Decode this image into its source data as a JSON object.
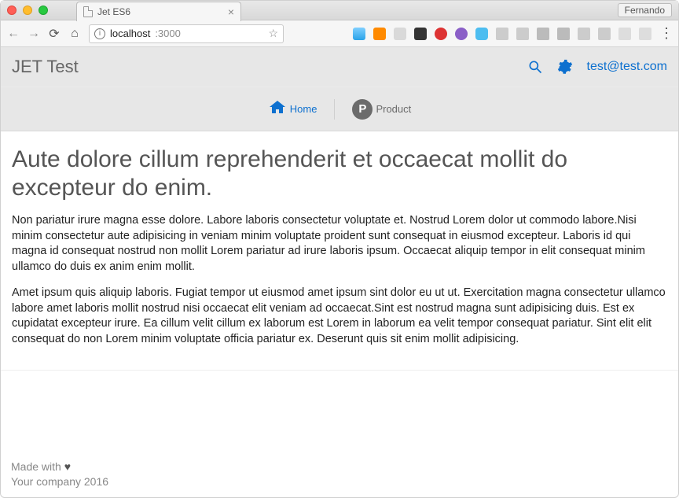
{
  "browser": {
    "tab_title": "Jet ES6",
    "user_label": "Fernando",
    "url_host": "localhost",
    "url_port": ":3000"
  },
  "header": {
    "app_title": "JET Test",
    "user_email": "test@test.com"
  },
  "nav": {
    "home": "Home",
    "product": "Product"
  },
  "article": {
    "heading": "Aute dolore cillum reprehenderit et occaecat mollit do excepteur do enim.",
    "p1": "Non pariatur irure magna esse dolore. Labore laboris consectetur voluptate et. Nostrud Lorem dolor ut commodo labore.Nisi minim consectetur aute adipisicing in veniam minim voluptate proident sunt consequat in eiusmod excepteur. Laboris id qui magna id consequat nostrud non mollit Lorem pariatur ad irure laboris ipsum. Occaecat aliquip tempor in elit consequat minim ullamco do duis ex anim enim mollit.",
    "p2": "Amet ipsum quis aliquip laboris. Fugiat tempor ut eiusmod amet ipsum sint dolor eu ut ut. Exercitation magna consectetur ullamco labore amet laboris mollit nostrud nisi occaecat elit veniam ad occaecat.Sint est nostrud magna sunt adipisicing duis. Est ex cupidatat excepteur irure. Ea cillum velit cillum ex laborum est Lorem in laborum ea velit tempor consequat pariatur. Sint elit elit consequat do non Lorem minim voluptate officia pariatur ex. Deserunt quis sit enim mollit adipisicing."
  },
  "footer": {
    "line1_pre": "Made with ",
    "line2": "Your company 2016"
  }
}
